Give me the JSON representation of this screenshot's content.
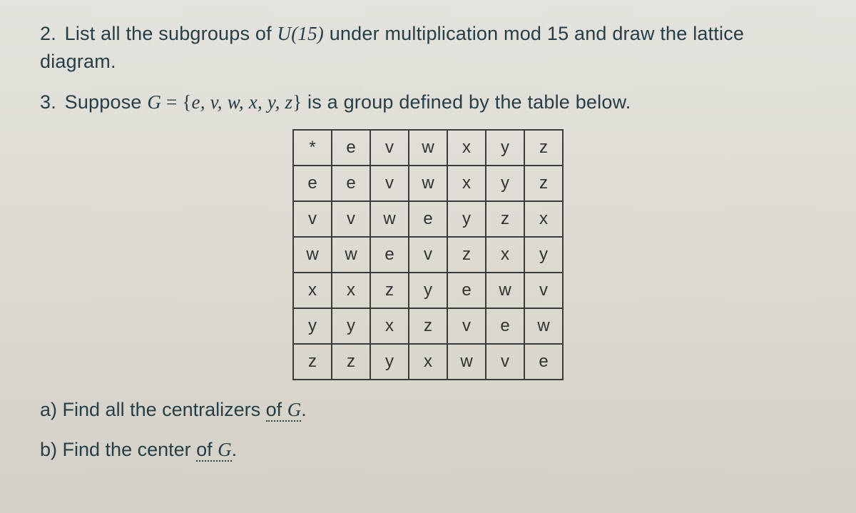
{
  "q2": {
    "number": "2.",
    "text_before": "List all the subgroups of ",
    "ufunc": "U(15)",
    "text_after": " under multiplication mod 15 and draw the lattice diagram."
  },
  "q3": {
    "number": "3.",
    "text_before": "Suppose ",
    "gvar": "G",
    "equals": " = ",
    "set_open": "{",
    "elements": "e, v, w, x, y, z",
    "set_close": "}",
    "text_after": " is a group defined by the table below."
  },
  "table": {
    "corner": "*",
    "headers": [
      "e",
      "v",
      "w",
      "x",
      "y",
      "z"
    ],
    "rows": [
      {
        "label": "e",
        "cells": [
          "e",
          "v",
          "w",
          "x",
          "y",
          "z"
        ]
      },
      {
        "label": "v",
        "cells": [
          "v",
          "w",
          "e",
          "y",
          "z",
          "x"
        ]
      },
      {
        "label": "w",
        "cells": [
          "w",
          "e",
          "v",
          "z",
          "x",
          "y"
        ]
      },
      {
        "label": "x",
        "cells": [
          "x",
          "z",
          "y",
          "e",
          "w",
          "v"
        ]
      },
      {
        "label": "y",
        "cells": [
          "y",
          "x",
          "z",
          "v",
          "e",
          "w"
        ]
      },
      {
        "label": "z",
        "cells": [
          "z",
          "y",
          "x",
          "w",
          "v",
          "e"
        ]
      }
    ]
  },
  "qa": {
    "label": "a)",
    "text_before": "Find all the centralizers ",
    "underlined": "of ",
    "gvar": "G",
    "period": "."
  },
  "qb": {
    "label": "b)",
    "text_before": "Find the center ",
    "underlined": "of ",
    "gvar": "G",
    "period": "."
  }
}
